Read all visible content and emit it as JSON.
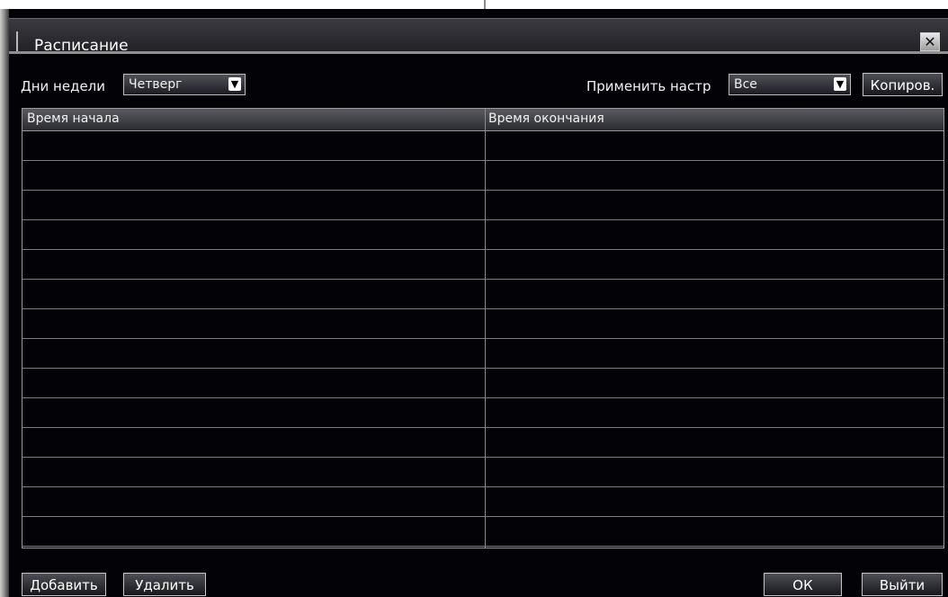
{
  "dialog": {
    "title": "Расписание",
    "close_symbol": "✕"
  },
  "toolbar": {
    "weekday_label": "Дни недели",
    "weekday_value": "Четверг",
    "apply_label": "Применить настр",
    "apply_value": "Все",
    "copy_label": "Копиров."
  },
  "table": {
    "columns": [
      "Время начала",
      "Время окончания"
    ],
    "rows": [
      "",
      "",
      "",
      "",
      "",
      "",
      "",
      "",
      "",
      "",
      "",
      "",
      "",
      ""
    ]
  },
  "footer": {
    "add_label": "Добавить",
    "delete_label": "Удалить",
    "ok_label": "ОК",
    "exit_label": "Выйти"
  },
  "icons": {
    "dropdown": "chevron-down-icon",
    "close": "close-icon"
  }
}
